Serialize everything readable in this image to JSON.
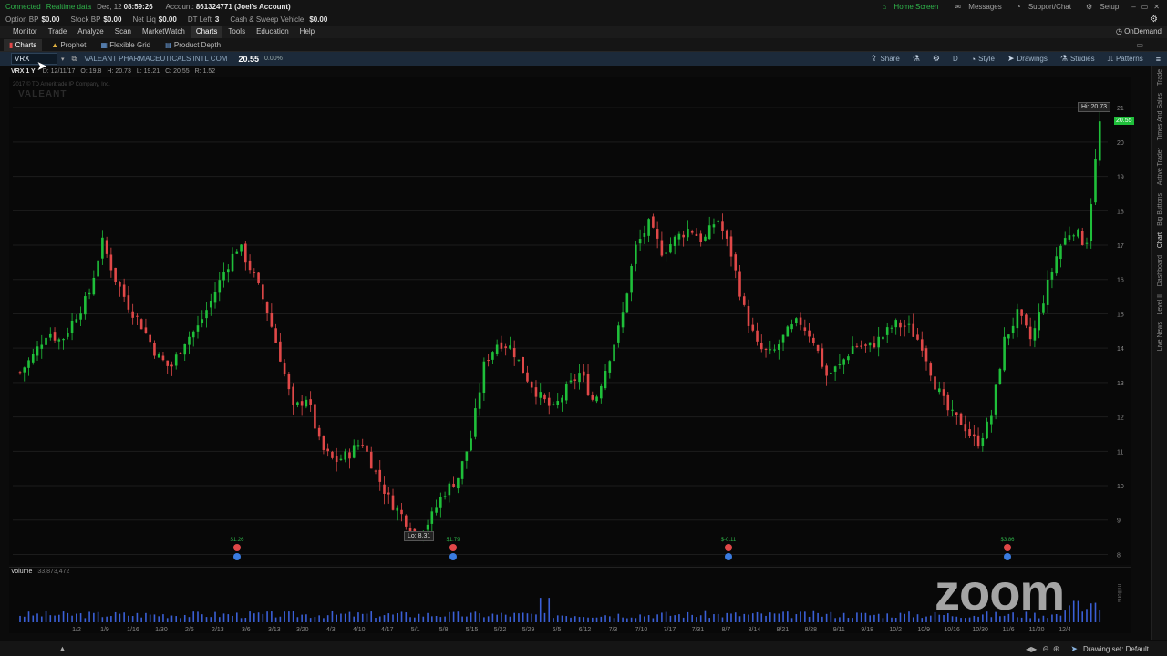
{
  "status": {
    "connected": "Connected",
    "realtime": "Realtime data",
    "date": "Dec, 12",
    "time": "08:59:26",
    "account_label": "Account:",
    "account": "861324771 (Joel's Account)",
    "home_screen": "Home Screen",
    "messages": "Messages",
    "support": "Support/Chat",
    "setup": "Setup"
  },
  "account_bar": {
    "option_bp_label": "Option BP",
    "option_bp": "$0.00",
    "stock_bp_label": "Stock BP",
    "stock_bp": "$0.00",
    "net_liq_label": "Net Liq",
    "net_liq": "$0.00",
    "dt_left_label": "DT Left",
    "dt_left": "3",
    "cash_label": "Cash & Sweep Vehicle",
    "cash": "$0.00"
  },
  "menu": [
    "Monitor",
    "Trade",
    "Analyze",
    "Scan",
    "MarketWatch",
    "Charts",
    "Tools",
    "Education",
    "Help"
  ],
  "menu_ondemand": "OnDemand",
  "subtabs": [
    "Charts",
    "Prophet",
    "Flexible Grid",
    "Product Depth"
  ],
  "chart_header": {
    "symbol": "VRX",
    "company": "VALEANT PHARMACEUTICALS INTL COM",
    "price": "20.55",
    "change": "0.00%",
    "share": "Share",
    "period": "D",
    "style": "Style",
    "drawings": "Drawings",
    "studies": "Studies",
    "patterns": "Patterns"
  },
  "info_row": {
    "label": "VRX 1 Y",
    "d": "D: 12/11/17",
    "o": "O: 19.8",
    "h": "H: 20.73",
    "l": "L: 19.21",
    "c": "C: 20.55",
    "r": "R: 1.52"
  },
  "watermark": "2017 © TD Ameritrade IP Company, Inc.",
  "watermark_logo": "VALEANT",
  "hi_label": "Hi: 20.73",
  "lo_label": "Lo: 8.31",
  "last_price_label": "20.55",
  "volume_label": "Volume",
  "volume_value": "33,873,472",
  "volume_unit": "millions",
  "zoom_watermark": "zoom",
  "drawing_set": "Drawing set: Default",
  "side_tabs": [
    "Trade",
    "Times And Sales",
    "Active Trader",
    "Big Buttons",
    "Chart",
    "Dashboard",
    "Level II",
    "Live News"
  ],
  "earnings_labels": [
    "$1.26",
    "$1.79",
    "$-0.11",
    "$3.86"
  ],
  "colors": {
    "up": "#1fbf3a",
    "down": "#e04848",
    "bg": "#080808",
    "grid": "#1c1c1c",
    "volume": "#3a5fd6"
  },
  "chart_data": {
    "type": "candlestick",
    "y_ticks": [
      8,
      9,
      10,
      11,
      12,
      13,
      14,
      15,
      16,
      17,
      18,
      19,
      20,
      21
    ],
    "ylim": [
      7.8,
      21.8
    ],
    "x_ticks": [
      "1/2",
      "1/9",
      "1/16",
      "1/30",
      "2/6",
      "2/13",
      "3/6",
      "3/13",
      "3/20",
      "4/3",
      "4/10",
      "4/17",
      "5/1",
      "5/8",
      "5/15",
      "5/22",
      "5/29",
      "6/5",
      "6/12",
      "7/3",
      "7/10",
      "7/17",
      "7/31",
      "8/7",
      "8/14",
      "8/21",
      "8/28",
      "9/11",
      "9/18",
      "10/2",
      "10/9",
      "10/16",
      "10/30",
      "11/6",
      "11/20",
      "12/4"
    ],
    "close_series": [
      13.3,
      13.8,
      14.5,
      14.2,
      14.9,
      15.5,
      17.1,
      16.0,
      15.2,
      14.6,
      13.8,
      13.4,
      14.2,
      14.6,
      15.4,
      16.3,
      17.0,
      16.2,
      15.2,
      13.8,
      12.2,
      12.6,
      11.1,
      10.7,
      10.9,
      11.3,
      10.4,
      9.6,
      9.1,
      8.6,
      9.0,
      9.8,
      10.2,
      11.4,
      13.6,
      14.2,
      14.0,
      13.2,
      12.6,
      12.2,
      12.8,
      13.3,
      12.4,
      13.6,
      14.8,
      16.9,
      17.6,
      16.8,
      17.2,
      17.5,
      17.1,
      17.8,
      16.8,
      15.1,
      14.0,
      13.8,
      14.4,
      14.8,
      14.3,
      13.2,
      13.5,
      14.1,
      14.0,
      14.3,
      14.7,
      14.6,
      14.1,
      12.9,
      12.1,
      11.8,
      11.2,
      11.9,
      14.2,
      15.0,
      14.2,
      15.6,
      16.9,
      17.5,
      17.0,
      20.55
    ],
    "volume_ylim": [
      0,
      100
    ],
    "volume_ticks": [
      10,
      30,
      50
    ]
  }
}
